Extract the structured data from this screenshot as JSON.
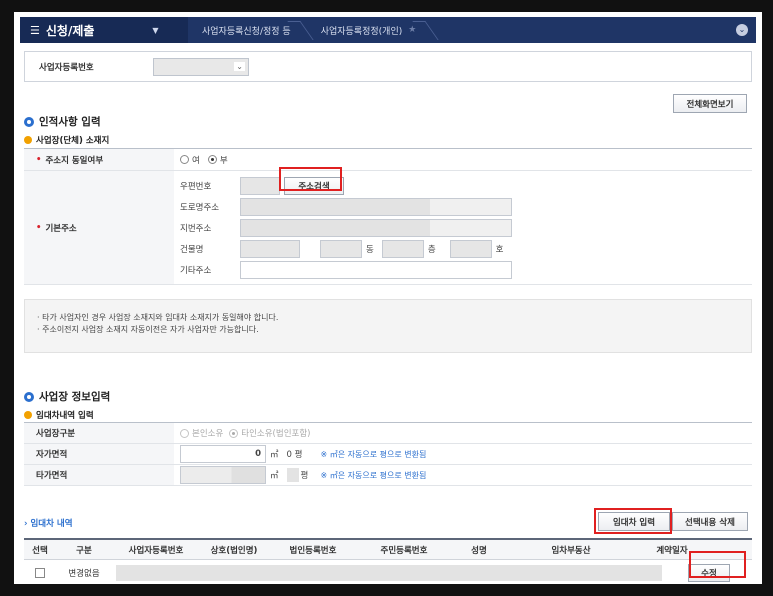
{
  "nav": {
    "menu_label": "신청/제출",
    "breadcrumbs": [
      "사업자등록신청/정정 등",
      "사업자등록정정(개인)"
    ]
  },
  "registration": {
    "label": "사업자등록번호"
  },
  "fullscreen_button": "전체화면보기",
  "section_personal": {
    "title": "인적사항 입력",
    "subtitle": "사업장(단체) 소재지",
    "same_address_label": "주소지 동일여부",
    "radio_yes": "여",
    "radio_no": "부",
    "base_address_label": "기본주소",
    "zip_label": "우편번호",
    "address_search_button": "주소검색",
    "road_address_label": "도로명주소",
    "lot_address_label": "지번주소",
    "building_label": "건물명",
    "dong_unit": "동",
    "floor_unit": "층",
    "room_unit": "호",
    "other_address_label": "기타주소"
  },
  "notice": [
    "타가 사업자인 경우 사업장 소재지와 임대차 소재지가 동일해야 합니다.",
    "주소이전지 사업장 소재지 자동이전은 자가 사업자만 가능합니다."
  ],
  "section_business": {
    "title": "사업장 정보입력",
    "subtitle": "임대차내역 입력",
    "type_label": "사업장구분",
    "type_own": "본인소유",
    "type_other": "타인소유(법인포함)",
    "own_area_label": "자가면적",
    "own_area_value": "0",
    "area_unit": "㎡",
    "own_pyeong": "0 평",
    "pyeong_unit": "평",
    "convert_note": "※ ㎡은 자동으로 평으로 변환됨",
    "other_area_label": "타가면적"
  },
  "lease": {
    "link": "› 임대차 내역",
    "input_button": "임대차 입력",
    "delete_button": "선택내용 삭제",
    "columns": [
      "선택",
      "구분",
      "사업자등록번호",
      "상호(법인명)",
      "법인등록번호",
      "주민등록번호",
      "성명",
      "임차부동산",
      "계약일자"
    ],
    "row_type": "변경없음",
    "edit_button": "수정"
  }
}
